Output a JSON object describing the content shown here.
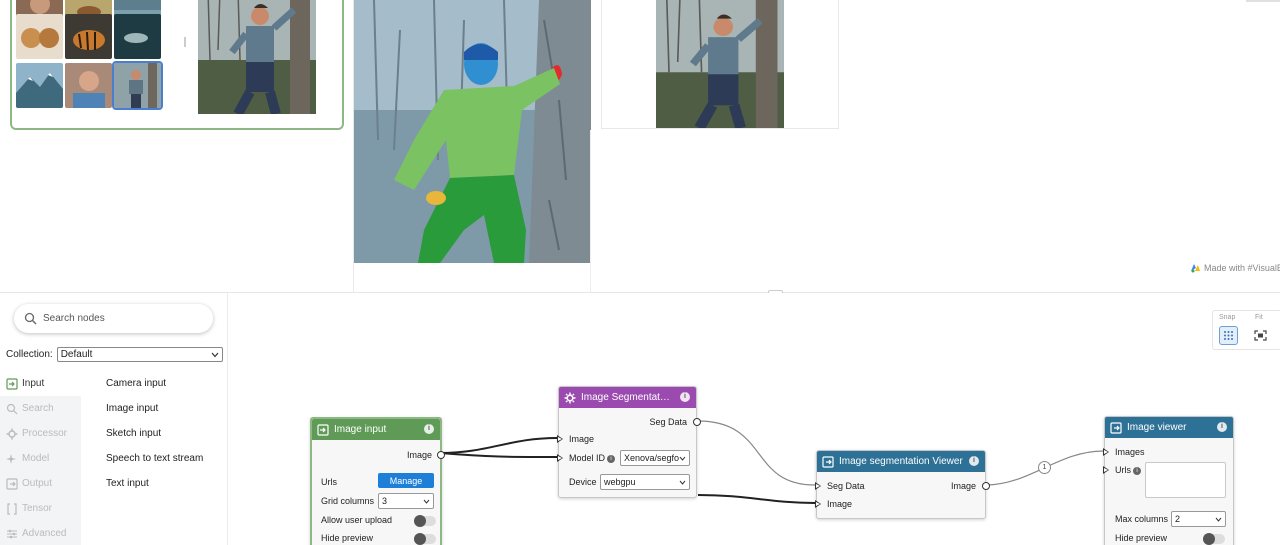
{
  "preview": {
    "made_with": "Made with #VisualB"
  },
  "sidebar": {
    "search_placeholder": "Search nodes",
    "collection_label": "Collection:",
    "collection_value": "Default",
    "categories": [
      {
        "label": "Input",
        "icon": "input-icon",
        "active": true
      },
      {
        "label": "Search",
        "icon": "search-icon",
        "active": false
      },
      {
        "label": "Processor",
        "icon": "gear-icon",
        "active": false
      },
      {
        "label": "Model",
        "icon": "sparkle-icon",
        "active": false
      },
      {
        "label": "Output",
        "icon": "output-icon",
        "active": false
      },
      {
        "label": "Tensor",
        "icon": "brackets-icon",
        "active": false
      },
      {
        "label": "Advanced",
        "icon": "sliders-icon",
        "active": false
      }
    ],
    "nodes": [
      "Camera input",
      "Image input",
      "Sketch input",
      "Speech to text stream",
      "Text input"
    ]
  },
  "canvas": {
    "snap_label": "Snap",
    "fit_label": "Fit",
    "image_input": {
      "title": "Image input",
      "out_image": "Image",
      "urls_label": "Urls",
      "manage": "Manage",
      "grid_columns_label": "Grid columns",
      "grid_columns_value": "3",
      "allow_upload": "Allow user upload",
      "hide_preview": "Hide preview",
      "color": "#5f9a57"
    },
    "segmentation": {
      "title": "Image Segmentat…",
      "seg_data": "Seg Data",
      "in_image": "Image",
      "model_id_label": "Model ID",
      "model_id_value": "Xenova/segfo",
      "device_label": "Device",
      "device_value": "webgpu",
      "color": "#9b4bb0"
    },
    "seg_viewer": {
      "title": "Image segmentation Viewer",
      "in_seg": "Seg Data",
      "in_image": "Image",
      "out_image": "Image",
      "color": "#2e7196"
    },
    "image_viewer": {
      "title": "Image viewer",
      "in_images": "Images",
      "urls_label": "Urls",
      "max_columns_label": "Max columns",
      "max_columns_value": "2",
      "hide_preview": "Hide preview",
      "color": "#2e7196"
    },
    "edge_badge": "1"
  }
}
